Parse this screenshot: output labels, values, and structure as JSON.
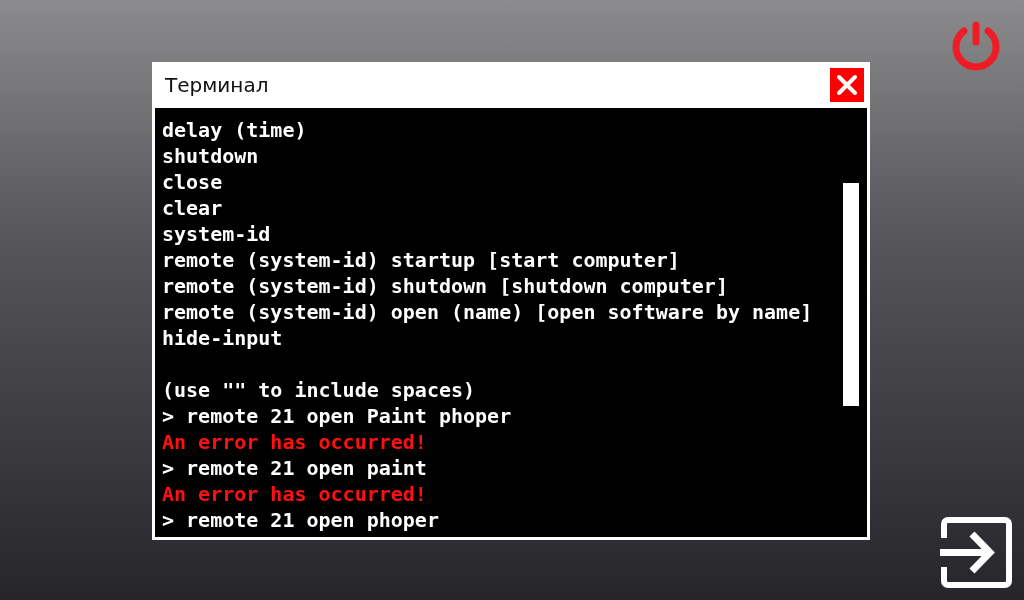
{
  "window": {
    "title": "Терминал"
  },
  "terminal": {
    "lines": [
      {
        "kind": "text",
        "text": "delay (time)"
      },
      {
        "kind": "text",
        "text": "shutdown"
      },
      {
        "kind": "text",
        "text": "close"
      },
      {
        "kind": "text",
        "text": "clear"
      },
      {
        "kind": "text",
        "text": "system-id"
      },
      {
        "kind": "text",
        "text": "remote (system-id) startup [start computer]"
      },
      {
        "kind": "text",
        "text": "remote (system-id) shutdown [shutdown computer]"
      },
      {
        "kind": "text",
        "text": "remote (system-id) open (name) [open software by name]"
      },
      {
        "kind": "text",
        "text": "hide-input"
      },
      {
        "kind": "blank"
      },
      {
        "kind": "text",
        "text": "(use \"\" to include spaces)"
      },
      {
        "kind": "text",
        "text": "> remote 21 open Paint phoper"
      },
      {
        "kind": "error",
        "text": "An error has occurred!"
      },
      {
        "kind": "text",
        "text": "> remote 21 open paint"
      },
      {
        "kind": "error",
        "text": "An error has occurred!"
      },
      {
        "kind": "text",
        "text": "> remote 21 open phoper"
      }
    ]
  }
}
